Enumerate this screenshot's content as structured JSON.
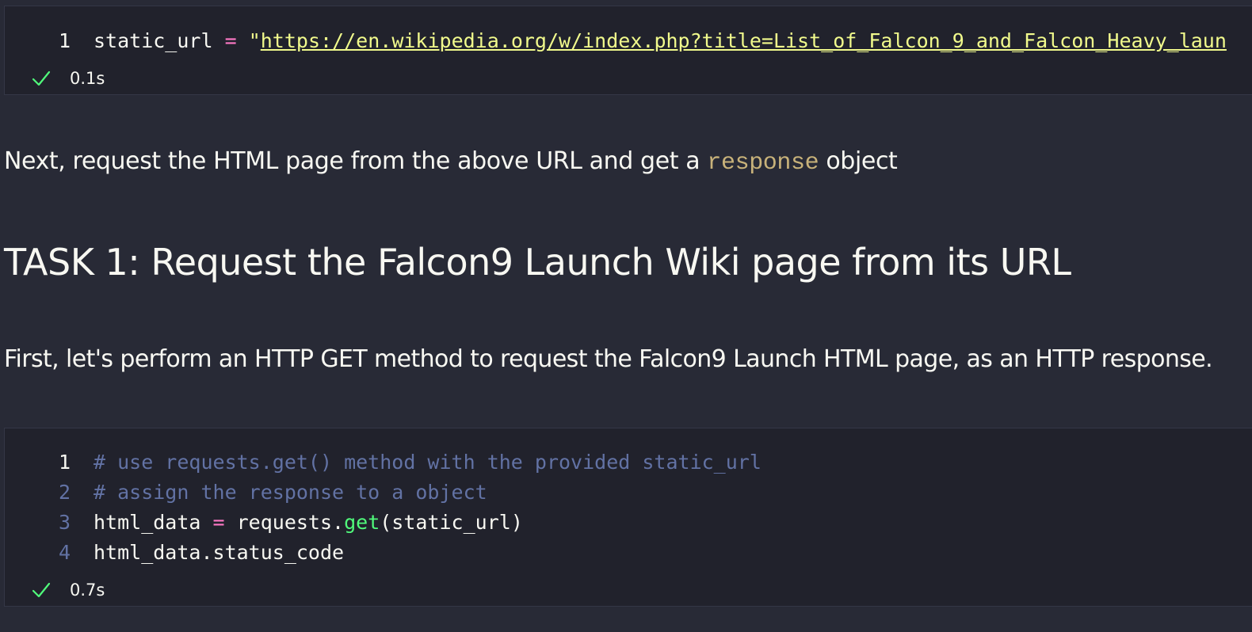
{
  "cells": [
    {
      "type": "code",
      "lines": [
        {
          "no": "1",
          "tokens": [
            {
              "t": "static_url ",
              "k": "plain"
            },
            {
              "t": "=",
              "k": "op"
            },
            {
              "t": " \"",
              "k": "str"
            },
            {
              "t": "https://en.wikipedia.org/w/index.php?title=List_of_Falcon_9_and_Falcon_Heavy_laun",
              "k": "url"
            }
          ]
        }
      ],
      "status": {
        "icon": "check-icon",
        "time": "0.1s"
      }
    },
    {
      "type": "code",
      "lines": [
        {
          "no": "1",
          "tokens": [
            {
              "t": "# use requests.get() method with the provided static_url",
              "k": "comment"
            }
          ]
        },
        {
          "no": "2",
          "tokens": [
            {
              "t": "# assign the response to a object",
              "k": "comment"
            }
          ]
        },
        {
          "no": "3",
          "tokens": [
            {
              "t": "html_data ",
              "k": "plain"
            },
            {
              "t": "=",
              "k": "op"
            },
            {
              "t": " requests.",
              "k": "plain"
            },
            {
              "t": "get",
              "k": "fn"
            },
            {
              "t": "(static_url)",
              "k": "plain"
            }
          ]
        },
        {
          "no": "4",
          "tokens": [
            {
              "t": "html_data.status_code",
              "k": "plain"
            }
          ]
        }
      ],
      "status": {
        "icon": "check-icon",
        "time": "0.7s"
      }
    }
  ],
  "markdown": {
    "next_before": "Next, request the HTML page from the above URL and get a ",
    "next_code": "response",
    "next_after": " object",
    "task1_heading": "TASK 1: Request the Falcon9 Launch Wiki page from its URL",
    "first_paragraph": "First, let's perform an HTTP GET method to request the Falcon9 Launch HTML page, as an HTTP response."
  },
  "colors": {
    "background": "#282a36",
    "cell_background": "#21222c",
    "success": "#50fa7b",
    "comment": "#6272a4",
    "string": "#f1fa8c",
    "operator": "#ff79c6",
    "function": "#50fa7b",
    "inline_code": "#c8b27a"
  }
}
